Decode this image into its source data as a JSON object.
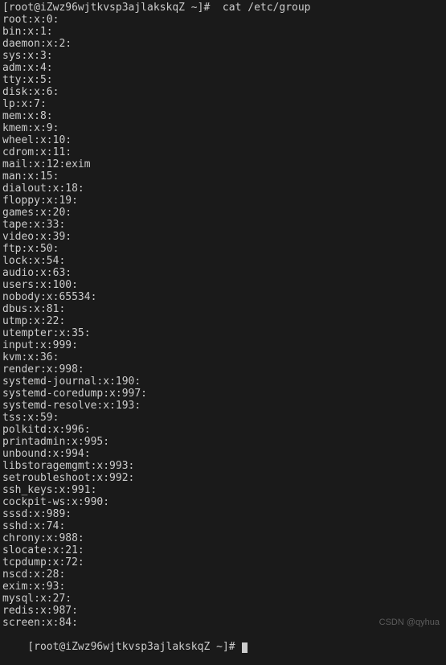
{
  "prompt": "[root@iZwz96wjtkvsp3ajlakskqZ ~]#  cat /etc/group",
  "lines": [
    "root:x:0:",
    "bin:x:1:",
    "daemon:x:2:",
    "sys:x:3:",
    "adm:x:4:",
    "tty:x:5:",
    "disk:x:6:",
    "lp:x:7:",
    "mem:x:8:",
    "kmem:x:9:",
    "wheel:x:10:",
    "cdrom:x:11:",
    "mail:x:12:exim",
    "man:x:15:",
    "dialout:x:18:",
    "floppy:x:19:",
    "games:x:20:",
    "tape:x:33:",
    "video:x:39:",
    "ftp:x:50:",
    "lock:x:54:",
    "audio:x:63:",
    "users:x:100:",
    "nobody:x:65534:",
    "dbus:x:81:",
    "utmp:x:22:",
    "utempter:x:35:",
    "input:x:999:",
    "kvm:x:36:",
    "render:x:998:",
    "systemd-journal:x:190:",
    "systemd-coredump:x:997:",
    "systemd-resolve:x:193:",
    "tss:x:59:",
    "polkitd:x:996:",
    "printadmin:x:995:",
    "unbound:x:994:",
    "libstoragemgmt:x:993:",
    "setroubleshoot:x:992:",
    "ssh_keys:x:991:",
    "cockpit-ws:x:990:",
    "sssd:x:989:",
    "sshd:x:74:",
    "chrony:x:988:",
    "slocate:x:21:",
    "tcpdump:x:72:",
    "nscd:x:28:",
    "exim:x:93:",
    "mysql:x:27:",
    "redis:x:987:",
    "screen:x:84:"
  ],
  "prompt2": "[root@iZwz96wjtkvsp3ajlakskqZ ~]# ",
  "watermark": "CSDN @qyhua"
}
